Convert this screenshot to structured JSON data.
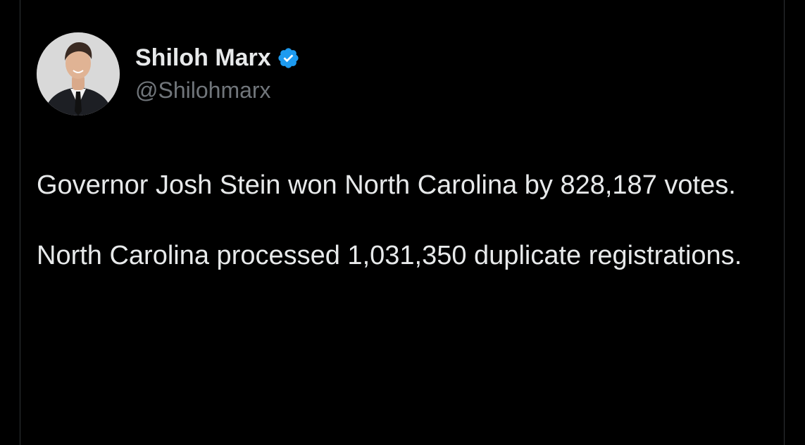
{
  "tweet": {
    "author": {
      "display_name": "Shiloh Marx",
      "handle": "@Shilohmarx",
      "verified": true,
      "avatar_icon": "profile-photo"
    },
    "paragraphs": [
      "Governor Josh Stein won North Carolina by 828,187 votes.",
      "North Carolina processed 1,031,350 duplicate registrations."
    ]
  },
  "colors": {
    "background": "#000000",
    "text_primary": "#e7e9ea",
    "text_secondary": "#71767b",
    "verified_badge": "#1d9bf0",
    "divider": "#2f3336"
  }
}
